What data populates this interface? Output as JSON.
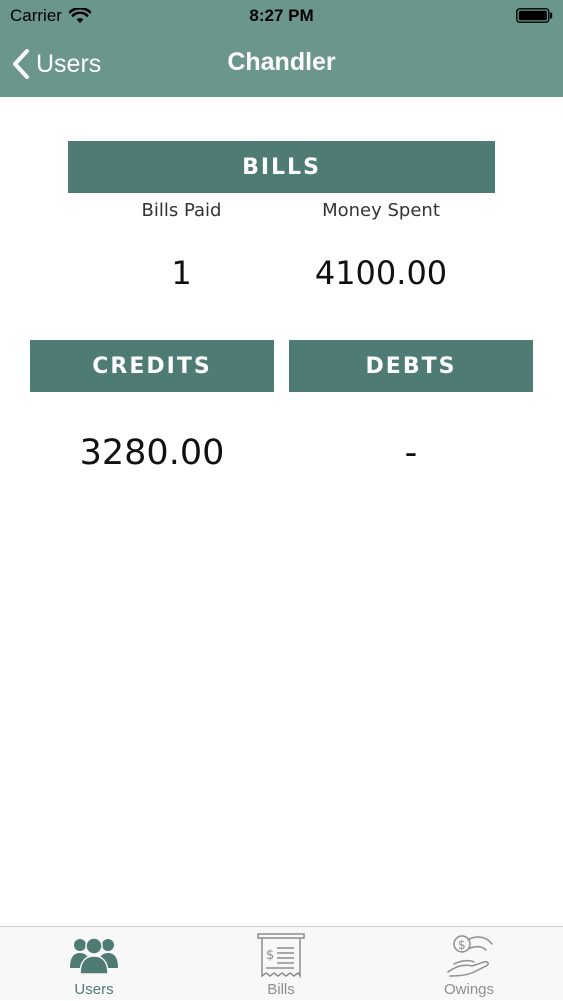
{
  "status_bar": {
    "carrier": "Carrier",
    "time": "8:27 PM",
    "wifi_icon": "wifi-icon",
    "battery_icon": "battery-icon"
  },
  "nav": {
    "back_label": "Users",
    "back_icon": "chevron-left-icon",
    "title": "Chandler"
  },
  "bills": {
    "header": "BILLS",
    "bills_paid_label": "Bills Paid",
    "bills_paid_value": "1",
    "money_spent_label": "Money Spent",
    "money_spent_value": "4100.00"
  },
  "credits": {
    "header": "CREDITS",
    "value": "3280.00"
  },
  "debts": {
    "header": "DEBTS",
    "value": "-"
  },
  "tabbar": {
    "tabs": [
      {
        "label": "Users",
        "icon": "users-icon",
        "active": true
      },
      {
        "label": "Bills",
        "icon": "receipt-icon",
        "active": false
      },
      {
        "label": "Owings",
        "icon": "hand-coin-icon",
        "active": false
      }
    ]
  },
  "colors": {
    "header_bar": "#6b968c",
    "banner": "#4e7c74",
    "tab_active": "#4e7c74",
    "tab_inactive": "#8e8e93"
  }
}
